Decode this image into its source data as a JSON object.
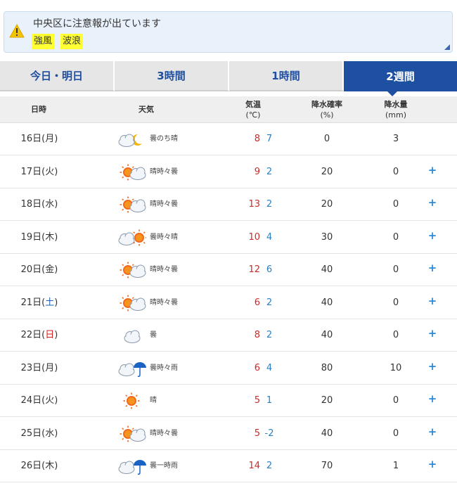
{
  "alert": {
    "title": "中央区に注意報が出ています",
    "tags": [
      "強風",
      "波浪"
    ]
  },
  "tabs": [
    {
      "label": "今日・明日",
      "active": false
    },
    {
      "label": "3時間",
      "active": false
    },
    {
      "label": "1時間",
      "active": false
    },
    {
      "label": "2週間",
      "active": true
    }
  ],
  "table": {
    "headers": {
      "date": "日時",
      "weather": "天気",
      "temp": "気温",
      "temp_unit": "(℃)",
      "pop": "降水確率",
      "pop_unit": "(%)",
      "precip": "降水量",
      "precip_unit": "(mm)"
    },
    "rows": [
      {
        "day": "16日(",
        "dow": "月",
        "close": ")",
        "dow_type": "weekday",
        "icon": "cloudy-night-icon",
        "weather": "曇のち晴",
        "max": "8",
        "min": "7",
        "pop": "0",
        "precip": "3",
        "expand": ""
      },
      {
        "day": "17日(",
        "dow": "火",
        "close": ")",
        "dow_type": "weekday",
        "icon": "sunny-cloudy-icon",
        "weather": "晴時々曇",
        "max": "9",
        "min": "2",
        "pop": "20",
        "precip": "0",
        "expand": "+"
      },
      {
        "day": "18日(",
        "dow": "水",
        "close": ")",
        "dow_type": "weekday",
        "icon": "sunny-cloudy-icon",
        "weather": "晴時々曇",
        "max": "13",
        "min": "2",
        "pop": "20",
        "precip": "0",
        "expand": "+"
      },
      {
        "day": "19日(",
        "dow": "木",
        "close": ")",
        "dow_type": "weekday",
        "icon": "cloudy-sunny-icon",
        "weather": "曇時々晴",
        "max": "10",
        "min": "4",
        "pop": "30",
        "precip": "0",
        "expand": "+"
      },
      {
        "day": "20日(",
        "dow": "金",
        "close": ")",
        "dow_type": "weekday",
        "icon": "sunny-cloudy-icon",
        "weather": "晴時々曇",
        "max": "12",
        "min": "6",
        "pop": "40",
        "precip": "0",
        "expand": "+"
      },
      {
        "day": "21日(",
        "dow": "土",
        "close": ")",
        "dow_type": "saturday",
        "icon": "sunny-cloudy-icon",
        "weather": "晴時々曇",
        "max": "6",
        "min": "2",
        "pop": "40",
        "precip": "0",
        "expand": "+"
      },
      {
        "day": "22日(",
        "dow": "日",
        "close": ")",
        "dow_type": "sunday",
        "icon": "cloud-icon",
        "weather": "曇",
        "max": "8",
        "min": "2",
        "pop": "40",
        "precip": "0",
        "expand": "+"
      },
      {
        "day": "23日(",
        "dow": "月",
        "close": ")",
        "dow_type": "weekday",
        "icon": "cloudy-rain-icon",
        "weather": "曇時々雨",
        "max": "6",
        "min": "4",
        "pop": "80",
        "precip": "10",
        "expand": "+"
      },
      {
        "day": "24日(",
        "dow": "火",
        "close": ")",
        "dow_type": "weekday",
        "icon": "sun-icon",
        "weather": "晴",
        "max": "5",
        "min": "1",
        "pop": "20",
        "precip": "0",
        "expand": "+"
      },
      {
        "day": "25日(",
        "dow": "水",
        "close": ")",
        "dow_type": "weekday",
        "icon": "sunny-cloudy-icon",
        "weather": "晴時々曇",
        "max": "5",
        "min": "-2",
        "pop": "40",
        "precip": "0",
        "expand": "+"
      },
      {
        "day": "26日(",
        "dow": "木",
        "close": ")",
        "dow_type": "weekday",
        "icon": "cloudy-rain-icon",
        "weather": "曇一時雨",
        "max": "14",
        "min": "2",
        "pop": "70",
        "precip": "1",
        "expand": "+"
      }
    ]
  },
  "colors": {
    "tab_active": "#1e50a2",
    "temp_max": "#cc2a2a",
    "temp_min": "#2a7fc0",
    "saturday": "#1e5fb4",
    "sunday": "#d21e1e",
    "alert_highlight": "#ffff33"
  }
}
